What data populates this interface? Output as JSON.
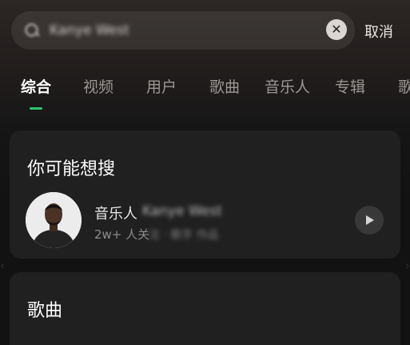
{
  "search": {
    "value": "Kanye West",
    "clear_icon": "close-icon",
    "cancel_label": "取消"
  },
  "tabs": [
    {
      "label": "综合",
      "active": true
    },
    {
      "label": "视频"
    },
    {
      "label": "用户"
    },
    {
      "label": "歌曲"
    },
    {
      "label": "音乐人"
    },
    {
      "label": "专辑"
    },
    {
      "label": "歌"
    }
  ],
  "suggest": {
    "title": "你可能想搜",
    "result": {
      "type_label": "音乐人",
      "name": "Kanye West",
      "fans_prefix": "2w+ 人关",
      "fans_rest": "注 · 歌手 作品"
    }
  },
  "songs": {
    "title": "歌曲"
  },
  "colors": {
    "accent": "#2bc86f",
    "card_bg": "#202020"
  }
}
